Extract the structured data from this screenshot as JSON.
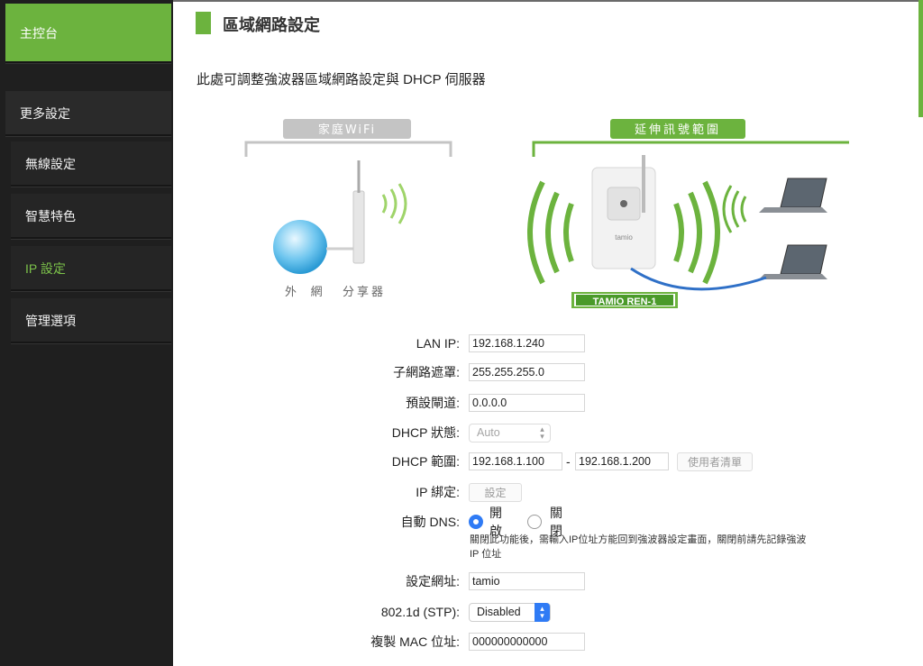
{
  "sidebar": {
    "items": [
      {
        "label": "主控台"
      },
      {
        "label": "更多設定"
      },
      {
        "label": "無線設定"
      },
      {
        "label": "智慧特色"
      },
      {
        "label": "IP 設定"
      },
      {
        "label": "管理選項"
      }
    ]
  },
  "header": {
    "title": "區域網路設定",
    "description": "此處可調整強波器區域網路設定與 DHCP 伺服器"
  },
  "illustration": {
    "home_wifi": "家庭WiFi",
    "extend_range": "延伸訊號範圍",
    "external_net": "外 網",
    "router": "分享器",
    "device": "TAMIO REN-1",
    "device_small": "tamio"
  },
  "form": {
    "lan_ip": {
      "label": "LAN IP:",
      "value": "192.168.1.240"
    },
    "subnet": {
      "label": "子網路遮罩:",
      "value": "255.255.255.0"
    },
    "gateway": {
      "label": "預設閘道:",
      "value": "0.0.0.0"
    },
    "dhcp_status": {
      "label": "DHCP 狀態:",
      "value": "Auto"
    },
    "dhcp_range": {
      "label": "DHCP 範圍:",
      "start": "192.168.1.100",
      "sep": "-",
      "end": "192.168.1.200",
      "user_list_button": "使用者清單"
    },
    "ip_bind": {
      "label": "IP 綁定:",
      "button": "設定"
    },
    "auto_dns": {
      "label": "自動 DNS:",
      "on": "開啟",
      "off": "關閉",
      "selected": "on",
      "note1": "關閉此功能後，需輸入IP位址方能回到強波器設定畫面，關閉前請先記錄強波",
      "note2": "IP 位址"
    },
    "hostname": {
      "label": "設定網址:",
      "value": "tamio"
    },
    "stp": {
      "label": "802.1d (STP):",
      "value": "Disabled"
    },
    "clone_mac": {
      "label": "複製 MAC 位址:",
      "value": "000000000000"
    }
  },
  "colors": {
    "accent": "#6cb33e",
    "sidebar_bg": "#1f1f1f",
    "select_blue": "#2f7bf5"
  }
}
